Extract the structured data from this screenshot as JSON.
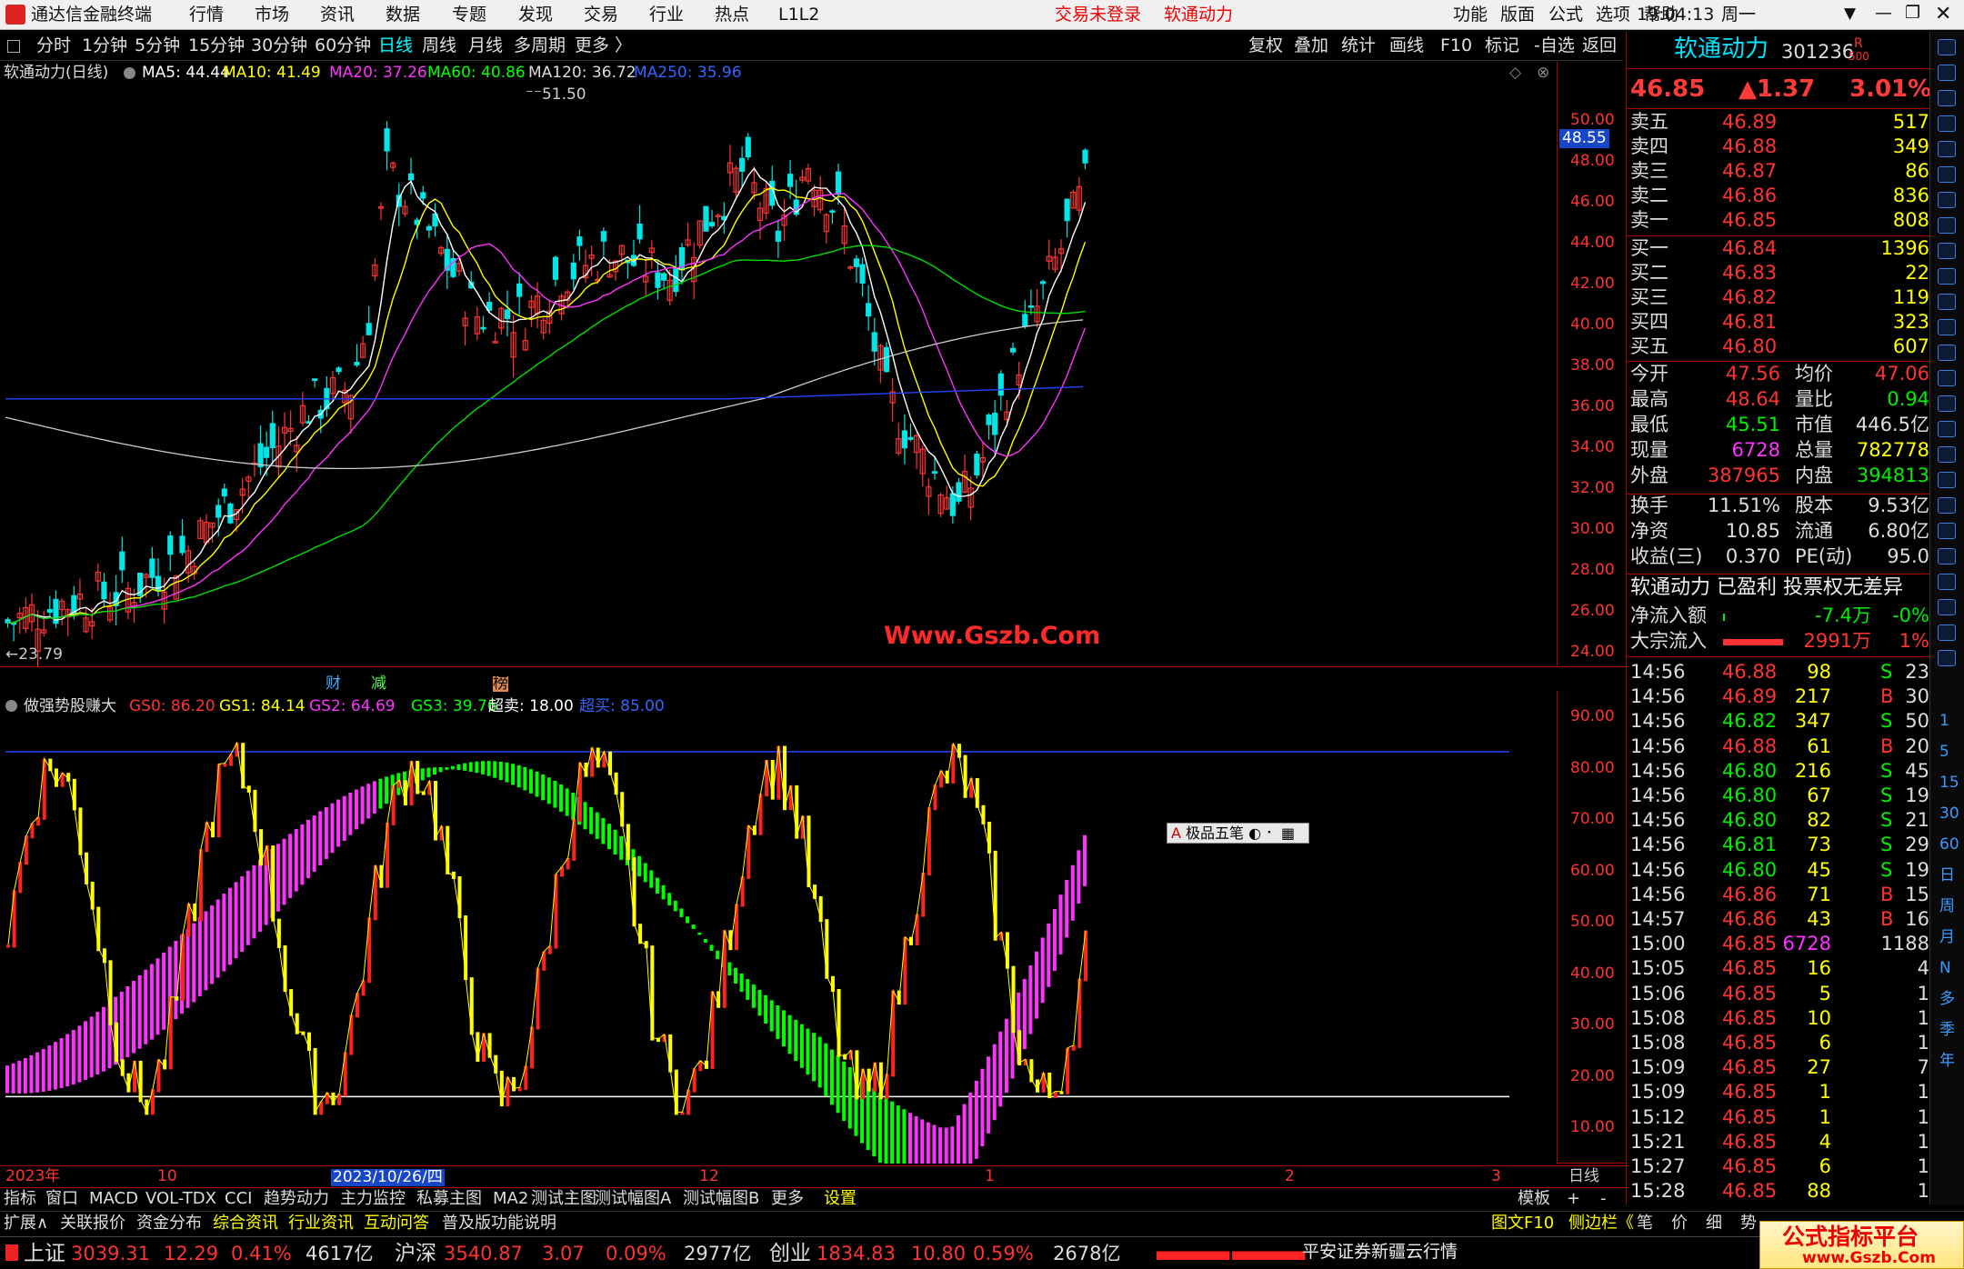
{
  "menubar": {
    "app_title": "通达信金融终端",
    "items": [
      "行情",
      "市场",
      "资讯",
      "数据",
      "专题",
      "发现",
      "交易",
      "行业",
      "热点",
      "L1L2"
    ],
    "trade_status": "交易未登录",
    "stock_name": "软通动力",
    "right_items": [
      "功能",
      "版面",
      "公式",
      "选项",
      "帮助"
    ],
    "time": "19:04:13",
    "weekday": "周一"
  },
  "toolbar": {
    "periods": [
      "分时",
      "1分钟",
      "5分钟",
      "15分钟",
      "30分钟",
      "60分钟",
      "日线",
      "周线",
      "月线",
      "多周期",
      "更多 〉"
    ],
    "active_period": "日线",
    "right_buttons": [
      "复权",
      "叠加",
      "统计",
      "画线",
      "F10",
      "标记",
      "-自选",
      "返回"
    ]
  },
  "main_chart": {
    "title": "软通动力(日线)",
    "ma": [
      {
        "label": "MA5: 44.44",
        "color": "#ffffff"
      },
      {
        "label": "MA10: 41.49",
        "color": "#ffff00"
      },
      {
        "label": "MA20: 37.26",
        "color": "#ff33ff"
      },
      {
        "label": "MA60: 40.86",
        "color": "#00ff00"
      },
      {
        "label": "MA120: 36.72",
        "color": "#dddddd"
      },
      {
        "label": "MA250: 35.96",
        "color": "#3366ff"
      }
    ],
    "high_label": "51.50",
    "low_label": "23.79",
    "current_price_tag": "48.55",
    "y_ticks": [
      "50.00",
      "48.00",
      "46.00",
      "44.00",
      "42.00",
      "40.00",
      "38.00",
      "36.00",
      "34.00",
      "32.00",
      "30.00",
      "28.00",
      "26.00",
      "24.00"
    ],
    "markers": [
      "财",
      "减",
      "榜"
    ],
    "watermark": "Www.Gszb.Com"
  },
  "indicator": {
    "title": "做强势股赚大",
    "params": [
      {
        "label": "GS0: 86.20",
        "color": "#ff3333"
      },
      {
        "label": "GS1: 84.14",
        "color": "#ffff00"
      },
      {
        "label": "GS2: 64.69",
        "color": "#ff33ff"
      },
      {
        "label": "GS3: 39.76",
        "color": "#00ff00"
      },
      {
        "label": "超卖: 18.00",
        "color": "#ffffff"
      },
      {
        "label": "超买: 85.00",
        "color": "#3366ff"
      }
    ],
    "y_ticks": [
      "90.00",
      "80.00",
      "70.00",
      "60.00",
      "50.00",
      "40.00",
      "30.00",
      "20.00",
      "10.00"
    ],
    "popup": "极品五笔"
  },
  "x_axis": {
    "labels": [
      "2023年",
      "10",
      "2023/10/26/四",
      "12",
      "1",
      "2",
      "3"
    ],
    "period_label": "日线"
  },
  "bottom_tabs": [
    "指标",
    "窗口",
    "MACD",
    "VOL-TDX",
    "CCI",
    "趋势动力",
    "主力监控",
    "私募主图",
    "MA2",
    "测试主图",
    "测试幅图A",
    "测试幅图B",
    "更多",
    "设置"
  ],
  "bottom_tabs_right": [
    "模板",
    "+",
    "-"
  ],
  "bottom_tabs2": [
    "扩展∧",
    "关联报价",
    "资金分布",
    "综合资讯",
    "行业资讯",
    "互动问答",
    "普及版功能说明"
  ],
  "bottom_tabs2_right": [
    "图文F10",
    "侧边栏《",
    "笔",
    "价",
    "细",
    "势"
  ],
  "quote": {
    "name": "软通动力",
    "code": "301236",
    "badge": "R",
    "badge2": "500",
    "price": "46.85",
    "change": "▲1.37",
    "pct": "3.01%",
    "asks": [
      [
        "卖五",
        "46.89",
        "517"
      ],
      [
        "卖四",
        "46.88",
        "349"
      ],
      [
        "卖三",
        "46.87",
        "86"
      ],
      [
        "卖二",
        "46.86",
        "836"
      ],
      [
        "卖一",
        "46.85",
        "808"
      ]
    ],
    "bids": [
      [
        "买一",
        "46.84",
        "1396"
      ],
      [
        "买二",
        "46.83",
        "22"
      ],
      [
        "买三",
        "46.82",
        "119"
      ],
      [
        "买四",
        "46.81",
        "323"
      ],
      [
        "买五",
        "46.80",
        "607"
      ]
    ],
    "stats": [
      [
        "今开",
        "47.56",
        "均价",
        "47.06"
      ],
      [
        "最高",
        "48.64",
        "量比",
        "0.94"
      ],
      [
        "最低",
        "45.51",
        "市值",
        "446.5亿"
      ],
      [
        "现量",
        "6728",
        "总量",
        "782778"
      ],
      [
        "外盘",
        "387965",
        "内盘",
        "394813"
      ],
      [
        "换手",
        "11.51%",
        "股本",
        "9.53亿"
      ],
      [
        "净资",
        "10.85",
        "流通",
        "6.80亿"
      ],
      [
        "收益(三)",
        "0.370",
        "PE(动)",
        "95.0"
      ]
    ],
    "tags": "软通动力 已盈利 投票权无差异",
    "flows": [
      [
        "净流入额",
        "-7.4万",
        "-0%"
      ],
      [
        "大宗流入",
        "2991万",
        "1%"
      ]
    ],
    "ticks": [
      [
        "14:56",
        "46.88",
        "98",
        "S",
        "23"
      ],
      [
        "14:56",
        "46.89",
        "217",
        "B",
        "30"
      ],
      [
        "14:56",
        "46.82",
        "347",
        "S",
        "50"
      ],
      [
        "14:56",
        "46.88",
        "61",
        "B",
        "20"
      ],
      [
        "14:56",
        "46.80",
        "216",
        "S",
        "45"
      ],
      [
        "14:56",
        "46.80",
        "67",
        "S",
        "19"
      ],
      [
        "14:56",
        "46.80",
        "82",
        "S",
        "21"
      ],
      [
        "14:56",
        "46.81",
        "73",
        "S",
        "29"
      ],
      [
        "14:56",
        "46.80",
        "45",
        "S",
        "19"
      ],
      [
        "14:56",
        "46.86",
        "71",
        "B",
        "15"
      ],
      [
        "14:57",
        "46.86",
        "43",
        "B",
        "16"
      ],
      [
        "15:00",
        "46.85",
        "6728",
        "",
        "1188"
      ],
      [
        "15:05",
        "46.85",
        "16",
        "",
        "4"
      ],
      [
        "15:06",
        "46.85",
        "5",
        "",
        "1"
      ],
      [
        "15:08",
        "46.85",
        "10",
        "",
        "1"
      ],
      [
        "15:08",
        "46.85",
        "6",
        "",
        "1"
      ],
      [
        "15:09",
        "46.85",
        "27",
        "",
        "7"
      ],
      [
        "15:09",
        "46.85",
        "1",
        "",
        "1"
      ],
      [
        "15:12",
        "46.85",
        "1",
        "",
        "1"
      ],
      [
        "15:21",
        "46.85",
        "4",
        "",
        "1"
      ],
      [
        "15:27",
        "46.85",
        "6",
        "",
        "1"
      ],
      [
        "15:28",
        "46.85",
        "88",
        "",
        "1"
      ]
    ]
  },
  "side_tabs": [
    "1",
    "5",
    "15",
    "30",
    "60",
    "日",
    "周",
    "月",
    "N",
    "多",
    "季",
    "年"
  ],
  "status": {
    "indices": [
      {
        "name": "上证",
        "value": "3039.31",
        "chg": "12.29",
        "pct": "0.41%",
        "amt": "4617亿"
      },
      {
        "name": "沪深",
        "value": "3540.87",
        "chg": "3.07",
        "pct": "0.09%",
        "amt": "2977亿"
      },
      {
        "name": "创业",
        "value": "1834.83",
        "chg": "10.80",
        "pct": "0.59%",
        "amt": "2678亿"
      }
    ],
    "broker": "平安证券新疆云行情",
    "brand": "公式指标平台",
    "brand_url": "www.Gszb.Com"
  },
  "colors": {
    "up": "#ff3333",
    "down": "#00e5e5",
    "bg": "#000000",
    "axis": "#aa0000"
  }
}
